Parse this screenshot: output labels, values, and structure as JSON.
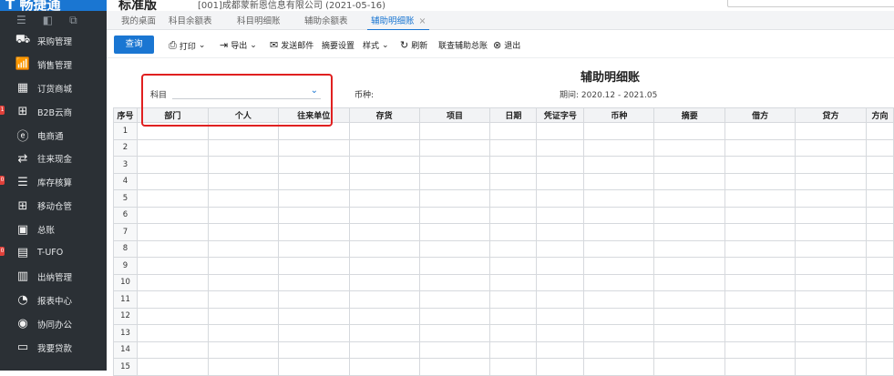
{
  "header": {
    "logo_text": "T 畅捷通",
    "product": "标准版",
    "company": "[001]成都蒙新恩信息有限公司 (2021-05-16)",
    "search_placeholder": ""
  },
  "sidebar": {
    "tools": [
      "☰",
      "◧",
      "⧉"
    ],
    "items": [
      {
        "label": "采购管理",
        "icon": "purchase-icon",
        "glyph": "⛟",
        "badge": ""
      },
      {
        "label": "销售管理",
        "icon": "sales-chart-icon",
        "glyph": "📶",
        "badge": ""
      },
      {
        "label": "订货商城",
        "icon": "store-icon",
        "glyph": "▦",
        "badge": ""
      },
      {
        "label": "B2B云商",
        "icon": "b2b-icon",
        "glyph": "⊞",
        "badge": "1"
      },
      {
        "label": "电商通",
        "icon": "ecommerce-icon",
        "glyph": "ⓔ",
        "badge": ""
      },
      {
        "label": "往来现金",
        "icon": "exchange-icon",
        "glyph": "⇄",
        "badge": ""
      },
      {
        "label": "库存核算",
        "icon": "inventory-icon",
        "glyph": "☰",
        "badge": "0"
      },
      {
        "label": "移动仓管",
        "icon": "mobile-warehouse-icon",
        "glyph": "⊞",
        "badge": ""
      },
      {
        "label": "总账",
        "icon": "ledger-icon",
        "glyph": "▣",
        "badge": ""
      },
      {
        "label": "T-UFO",
        "icon": "ufo-icon",
        "glyph": "▤",
        "badge": "0"
      },
      {
        "label": "出纳管理",
        "icon": "cashier-icon",
        "glyph": "▥",
        "badge": ""
      },
      {
        "label": "报表中心",
        "icon": "report-center-icon",
        "glyph": "◔",
        "badge": ""
      },
      {
        "label": "协同办公",
        "icon": "collaboration-icon",
        "glyph": "◉",
        "badge": ""
      },
      {
        "label": "我要贷款",
        "icon": "loan-icon",
        "glyph": "▭",
        "badge": ""
      }
    ]
  },
  "tabs": [
    {
      "label": "我的桌面",
      "active": false
    },
    {
      "label": "科目余额表",
      "active": false
    },
    {
      "label": "科目明细账",
      "active": false
    },
    {
      "label": "辅助余额表",
      "active": false
    },
    {
      "label": "辅助明细账",
      "active": true,
      "close": "×"
    }
  ],
  "toolbar": {
    "query": "查询",
    "print": "打印",
    "export": "导出",
    "send_mail": "发送邮件",
    "summary_settings": "摘要设置",
    "style": "样式",
    "refresh": "刷新",
    "link_aux": "联查辅助总账",
    "exit": "退出"
  },
  "report": {
    "title": "辅助明细账",
    "period_label": "期间:",
    "period_value": "2020.12 - 2021.05",
    "subject_label": "科目",
    "subject_value": "",
    "currency_label": "币种:"
  },
  "table": {
    "columns": [
      "序号",
      "部门",
      "个人",
      "往来单位",
      "存货",
      "项目",
      "日期",
      "凭证字号",
      "币种",
      "摘要",
      "借方",
      "贷方",
      "方向"
    ],
    "rows": [
      "1",
      "2",
      "3",
      "4",
      "5",
      "6",
      "7",
      "8",
      "9",
      "10",
      "11",
      "12",
      "13",
      "14",
      "15"
    ]
  },
  "colors": {
    "accent": "#1a76d2",
    "sidebar_bg": "#2b3035",
    "highlight": "#e02020",
    "badge": "#e0403a"
  }
}
